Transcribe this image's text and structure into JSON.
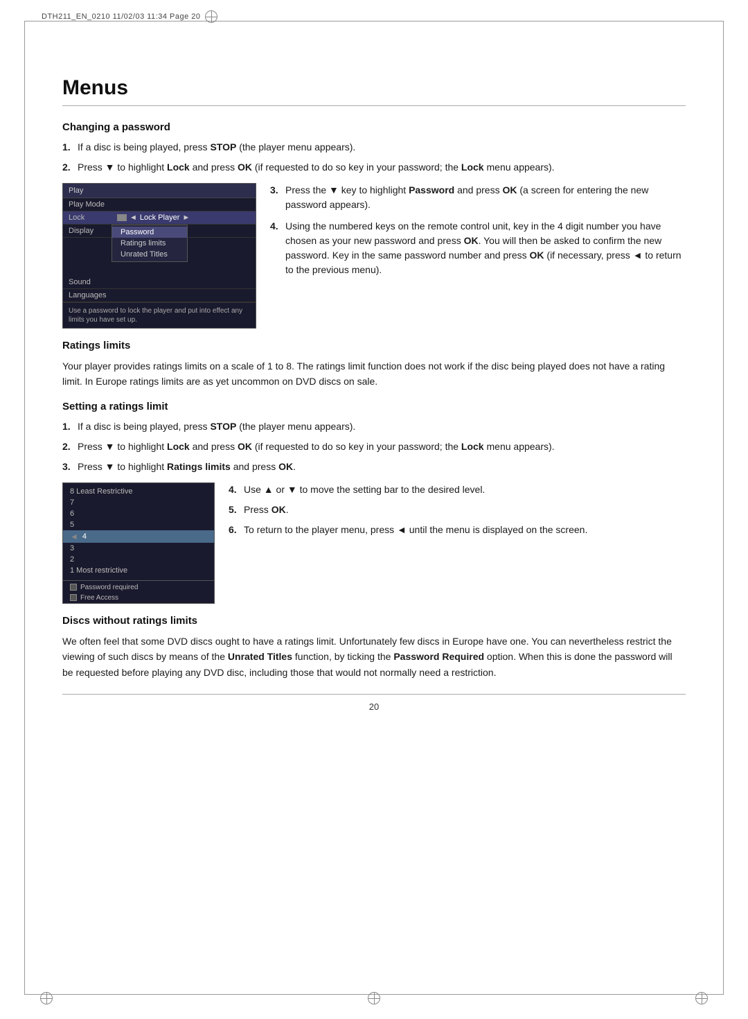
{
  "header": {
    "text": "DTH211_EN_0210   11/02/03   11:34   Page  20"
  },
  "page": {
    "title": "Menus"
  },
  "sections": {
    "changing_password": {
      "heading": "Changing a password",
      "step1": "If a disc is being played, press ",
      "step1_bold": "STOP",
      "step1_end": " (the player menu appears).",
      "step2_start": "Press ",
      "step2_arrow": "▼",
      "step2_mid": " to highlight ",
      "step2_bold1": "Lock",
      "step2_mid2": " and press ",
      "step2_bold2": "OK",
      "step2_end": " (if requested to do so key in your password; the ",
      "step2_bold3": "Lock",
      "step2_end2": " menu appears).",
      "step3_start": "Press the ",
      "step3_arrow": "▼",
      "step3_mid": " key to highlight ",
      "step3_bold": "Password",
      "step3_mid2": " and press ",
      "step3_bold2": "OK",
      "step3_end": " (a screen for entering the new password appears).",
      "step4_start": "Using the numbered keys on the remote control unit, key in the 4 digit number you have chosen as your new password and press ",
      "step4_bold": "OK",
      "step4_mid": ". You will then be asked to confirm the new password. Key in the same password number and press ",
      "step4_bold2": "OK",
      "step4_mid2": " (if necessary, press ",
      "step4_arrow": "◄",
      "step4_end": " to return to the previous menu).",
      "menu_screenshot": {
        "top_bar": "Play",
        "row1_label": "Play Mode",
        "row2_label": "Lock",
        "row2_value": "Lock Player",
        "row3_label": "Display",
        "row3_value": "Password",
        "row4_label": "Sound",
        "row4_value": "Ratings limits",
        "row5_label": "Languages",
        "row5_value": "Unrated Titles",
        "footer": "Use a password to lock the player and put into effect any limits you have set up."
      }
    },
    "ratings_limits": {
      "heading": "Ratings limits",
      "para": "Your player provides ratings limits on a scale of 1 to 8. The ratings limit function does not work if the disc being played does not have a rating limit. In Europe ratings limits are as yet uncommon on DVD discs on sale."
    },
    "setting_ratings": {
      "heading": "Setting a ratings limit",
      "step1_start": "If a disc is being played, press ",
      "step1_bold": "STOP",
      "step1_end": " (the player menu appears).",
      "step2_start": "Press ",
      "step2_arrow": "▼",
      "step2_mid": " to highlight ",
      "step2_bold1": "Lock",
      "step2_mid2": " and press ",
      "step2_bold2": "OK",
      "step2_end": " (if requested to do so key in your password; the ",
      "step2_bold3": "Lock",
      "step2_end2": " menu appears).",
      "step3_start": "Press ",
      "step3_arrow": "▼",
      "step3_mid": " to highlight ",
      "step3_bold": "Ratings limits",
      "step3_end": " and press ",
      "step3_bold2": "OK",
      "step3_end2": ".",
      "step4_start": "Use ",
      "step4_arrow1": "▲",
      "step4_or": " or ",
      "step4_arrow2": "▼",
      "step4_end": " to move the setting bar to the desired level.",
      "step5_start": "Press ",
      "step5_bold": "OK",
      "step5_end": ".",
      "step6_start": "To return to the player menu, press ",
      "step6_arrow": "◄",
      "step6_end": " until the menu is displayed on the screen.",
      "ratings_screenshot": {
        "item8": "8 Least Restrictive",
        "item7": "7",
        "item6": "6",
        "item5": "5",
        "item4": "4",
        "item3": "3",
        "item2": "2",
        "item1": "1 Most restrictive",
        "option1": "Password required",
        "option2": "Free Access"
      }
    },
    "discs_without": {
      "heading": "Discs without ratings limits",
      "para1_start": "We often feel that some DVD discs ought to have a ratings limit. Unfortunately few discs in Europe have one. You can nevertheless restrict the viewing of such discs by means of the ",
      "para1_bold1": "Unrated Titles",
      "para1_mid": " function, by ticking the ",
      "para1_bold2": "Password Required",
      "para1_mid2": " option. When this is done the password will be requested before playing any DVD disc, including those that would not normally need a restriction."
    }
  },
  "footer": {
    "page_number": "20"
  }
}
